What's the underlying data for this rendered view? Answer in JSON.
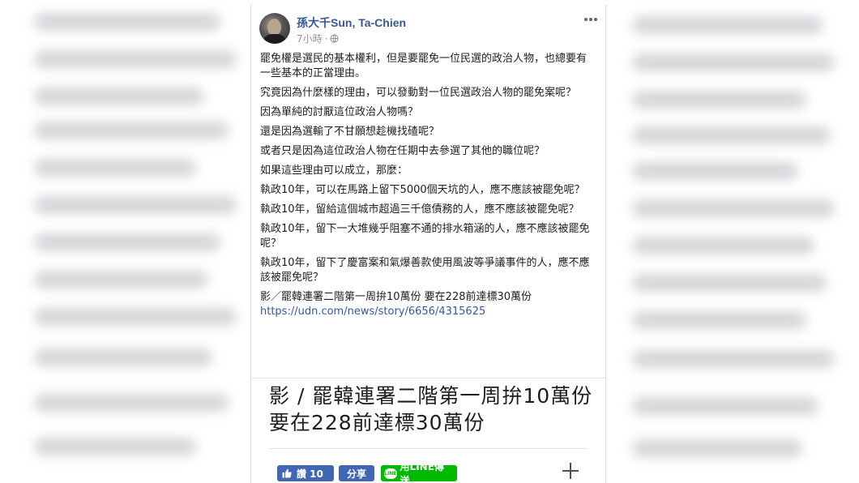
{
  "post": {
    "author": "孫大千Sun, Ta-Chien",
    "time": "7小時",
    "separator": "·",
    "paragraphs": [
      "罷免權是選民的基本權利，但是要罷免一位民選的政治人物，也總要有一些基本的正當理由。",
      "究竟因為什麼樣的理由，可以發動對一位民選政治人物的罷免案呢？",
      "因為單純的討厭這位政治人物嗎？",
      "還是因為選輸了不甘願想趁機找碴呢？",
      "或者只是因為這位政治人物在任期中去參選了其他的職位呢？",
      "如果這些理由可以成立，那麼：",
      "執政10年，可以在馬路上留下5000個天坑的人，應不應該被罷免呢？",
      "執政10年，留給這個城市超過三千億債務的人，應不應該被罷免呢？",
      "執政10年，留下一大堆幾乎阻塞不通的排水箱涵的人，應不應該被罷免呢？",
      "執政10年，留下了慶富案和氣爆善款使用風波等爭議事件的人，應不應該被罷免呢？",
      "影／罷韓連署二階第一周拚10萬份 要在228前達標30萬份"
    ],
    "link": "https://udn.com/news/story/6656/4315625"
  },
  "preview": {
    "title": "影 / 罷韓連署二階第一周拚10萬份 要在228前達標30萬份"
  },
  "actions": {
    "like_label": "讚 10",
    "share_label": "分享",
    "line_badge": "LINE",
    "line_label": "用LINE傳送"
  },
  "colors": {
    "author": "#385898",
    "facebook_blue": "#4267b2",
    "line_green": "#00b900"
  },
  "icons": {
    "globe": "globe-icon",
    "more": "more-options-icon",
    "like": "thumbs-up-icon",
    "plus": "plus-icon"
  }
}
